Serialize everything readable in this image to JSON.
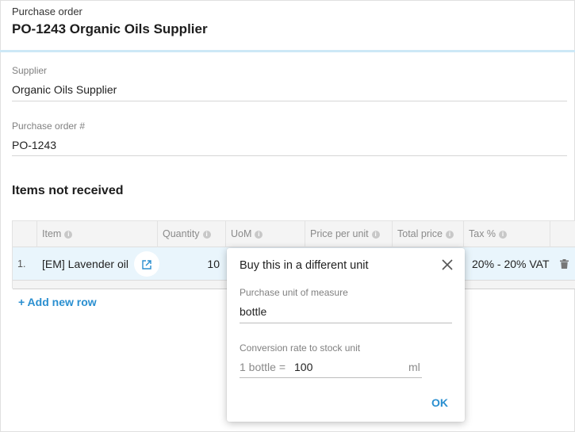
{
  "header": {
    "eyebrow": "Purchase order",
    "title": "PO-1243 Organic Oils Supplier"
  },
  "fields": {
    "supplier": {
      "label": "Supplier",
      "value": "Organic Oils Supplier"
    },
    "po_number": {
      "label": "Purchase order #",
      "value": "PO-1243"
    }
  },
  "section": {
    "title": "Items not received"
  },
  "table": {
    "columns": [
      "Item",
      "Quantity",
      "UoM",
      "Price per unit",
      "Total price",
      "Tax %"
    ],
    "rows": [
      {
        "num": "1.",
        "item": "[EM] Lavender oil",
        "quantity": "10",
        "tax": "20% - 20% VAT"
      }
    ],
    "info_icon_glyph": "i"
  },
  "add_row_label": "+ Add new row",
  "dialog": {
    "title": "Buy this in a different unit",
    "purchase_unit_label": "Purchase unit of measure",
    "purchase_unit_value": "bottle",
    "conversion_label": "Conversion rate to stock unit",
    "conversion_prefix": "1 bottle =",
    "conversion_value": "100",
    "conversion_unit": "ml",
    "ok_label": "OK"
  },
  "icons": {
    "close": "close-icon",
    "external_link": "external-link-icon",
    "trash": "trash-icon",
    "info": "info-icon"
  },
  "colors": {
    "accent": "#2a8fd0",
    "row_highlight": "#e9f5fc",
    "header_border": "#cde8f6"
  }
}
